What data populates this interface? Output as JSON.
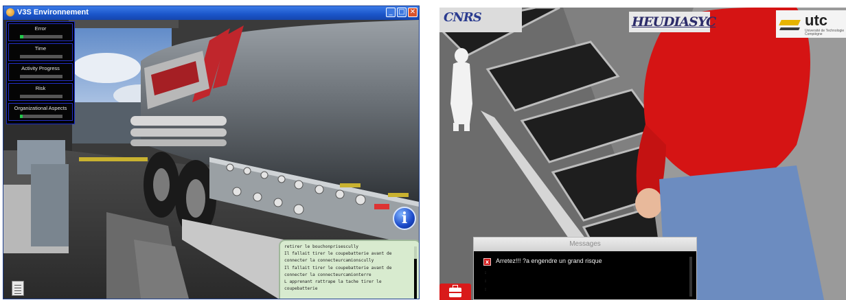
{
  "left_window": {
    "title": "V3S Environnement",
    "controls": {
      "minimize": "_",
      "maximize": "□",
      "close": "✕"
    },
    "hud": [
      {
        "label": "Error",
        "level": 0.08
      },
      {
        "label": "Time",
        "level": 0
      },
      {
        "label": "Activity Progress",
        "level": 0
      },
      {
        "label": "Risk",
        "level": 0
      },
      {
        "label": "Organizational Aspects",
        "level": 0.07
      }
    ],
    "info_button": "i",
    "log": [
      "retirer le bouchonprisescully",
      "Il fallait tirer le coupebatterie avant de",
      "connecter la connecteurcamionscully",
      "Il fallait tirer le coupebatterie avant de",
      "connecter la connecteurcamionterre",
      "L apprenant rattrape la tache  tirer le",
      "coupebatterie"
    ]
  },
  "right_scene": {
    "logos": {
      "cnrs": "CNRS",
      "heudiasyc": "HEUDIASYC",
      "utc": "utc",
      "utc_sub": "Université de Technologie Compiègne"
    },
    "messages": {
      "header": "Messages",
      "entry_icon": "x",
      "entry": "Arretez!!! ?a engendre un grand risque",
      "dots": [
        ":",
        ":",
        ":"
      ]
    },
    "toolbox_icon": "toolbox-icon"
  },
  "colors": {
    "hud_fill": "#22c84a",
    "titlebar": "#1a55c9",
    "log_bg": "#d8ebcf",
    "alert": "#d21c1c"
  }
}
